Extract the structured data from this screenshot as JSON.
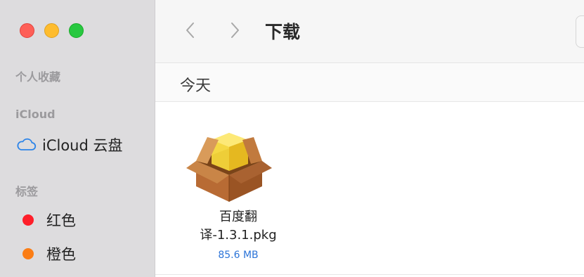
{
  "window": {
    "title": "下载",
    "traffic_lights": [
      "close",
      "minimize",
      "zoom"
    ]
  },
  "sidebar": {
    "sections": {
      "favorites": "个人收藏",
      "icloud": "iCloud",
      "tags": "标签"
    },
    "icloud_drive": {
      "label": "iCloud 云盘",
      "icon": "cloud-icon"
    },
    "tags": [
      {
        "label": "红色",
        "color": "#fe1f2a"
      },
      {
        "label": "橙色",
        "color": "#fb7d15"
      }
    ]
  },
  "toolbar": {
    "back_icon": "chevron-left-icon",
    "forward_icon": "chevron-right-icon"
  },
  "group": {
    "label": "今天"
  },
  "files": [
    {
      "name_line1": "百度翻",
      "name_line2": "译-1.3.1.pkg",
      "size": "85.6 MB",
      "icon": "package-icon"
    }
  ],
  "colors": {
    "sidebar_bg": "#dddcde",
    "accent_link": "#2c74d8"
  }
}
